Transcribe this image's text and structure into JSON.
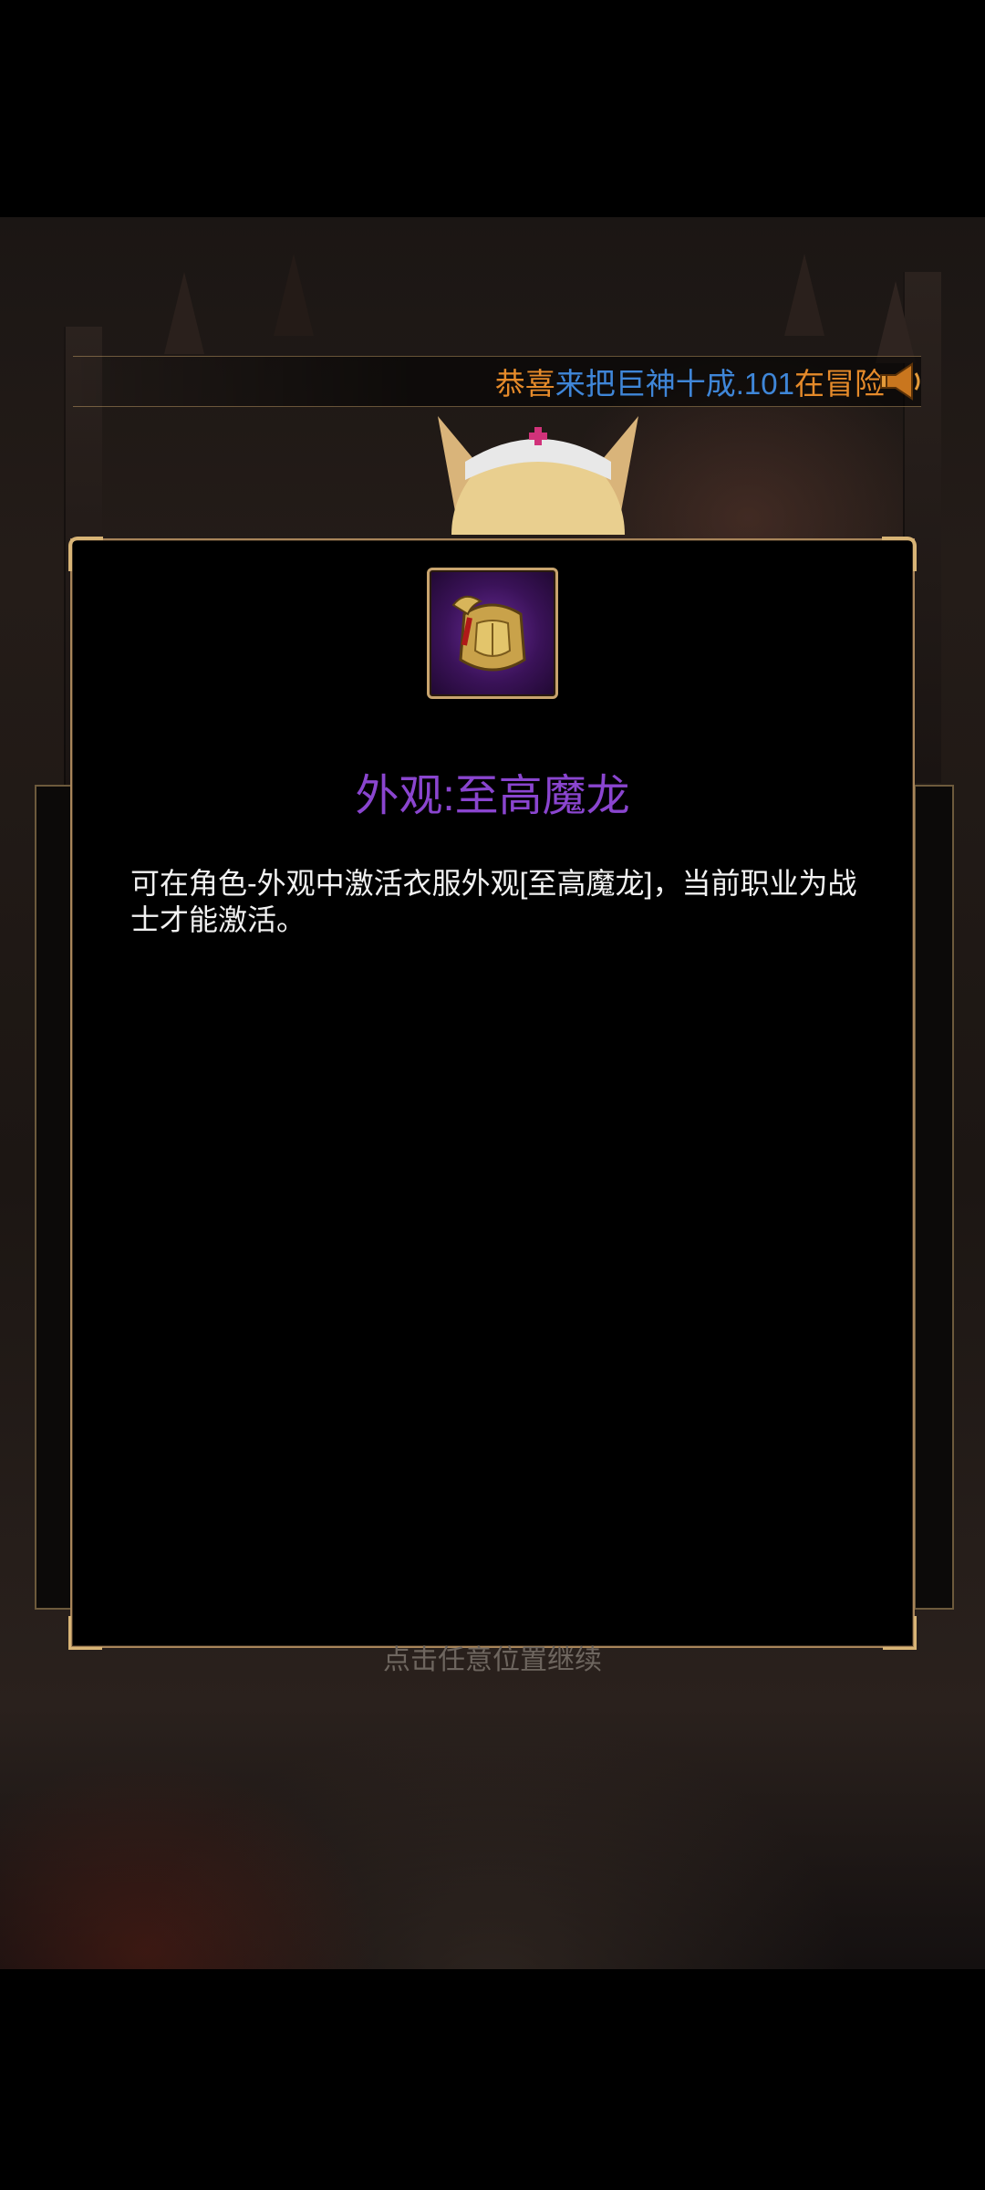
{
  "announcement": {
    "prefix": "恭喜",
    "player": "来把巨神十成.101",
    "suffix": "在冒险",
    "icon": "megaphone-icon",
    "colors": {
      "prefix": "#e58a2a",
      "player": "#3f86d8",
      "suffix": "#e58a2a"
    }
  },
  "dialog": {
    "item_icon": "golden-dragon-armor-icon",
    "title": "外观:至高魔龙",
    "title_color": "#8a45cf",
    "description": "可在角色-外观中激活衣服外观[至高魔龙]，当前职业为战士才能激活。"
  },
  "hint": "点击任意位置继续"
}
